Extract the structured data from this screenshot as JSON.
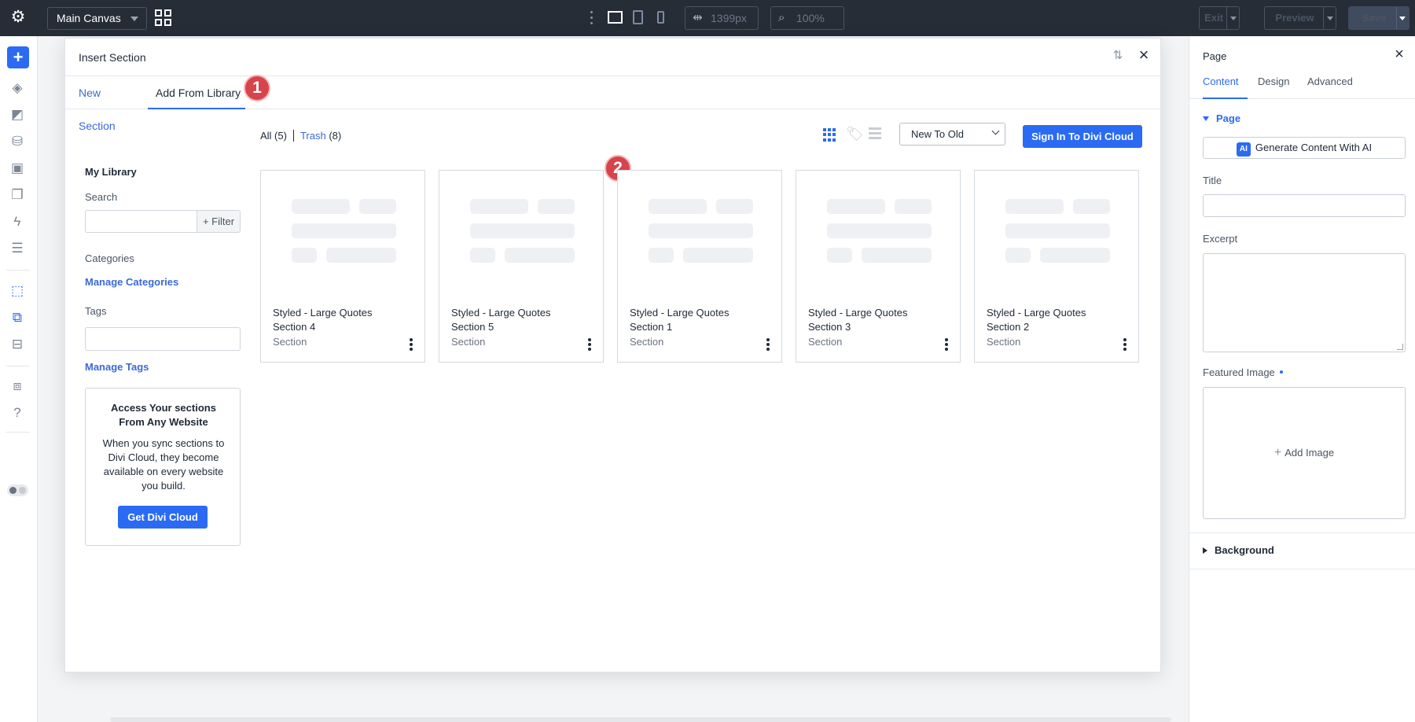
{
  "topbar": {
    "canvas_select": "Main Canvas",
    "width_value": "1399px",
    "zoom_value": "100%",
    "exit_label": "Exit",
    "preview_label": "Preview",
    "save_label": "Save"
  },
  "modal": {
    "title": "Insert Section",
    "tabs": [
      {
        "label": "New Section"
      },
      {
        "label": "Add From Library"
      }
    ],
    "badges": [
      "1",
      "2"
    ]
  },
  "library": {
    "heading": "My Library",
    "search_label": "Search",
    "filter_label": "+ Filter",
    "categories_label": "Categories",
    "manage_categories": "Manage Categories",
    "tags_label": "Tags",
    "manage_tags": "Manage Tags",
    "promo": {
      "title": "Access Your sections From Any Website",
      "body": "When you sync sections to Divi Cloud, they become available on every website you build.",
      "button": "Get Divi Cloud"
    },
    "all_label": "All (5)",
    "trash_label": "Trash",
    "trash_count": "(8)",
    "sort_value": "New To Old",
    "cloud_button": "Sign In To Divi Cloud",
    "items": [
      {
        "title": "Styled - Large Quotes Section 4",
        "type": "Section"
      },
      {
        "title": "Styled - Large Quotes Section 5",
        "type": "Section"
      },
      {
        "title": "Styled - Large Quotes Section 1",
        "type": "Section"
      },
      {
        "title": "Styled - Large Quotes Section 3",
        "type": "Section"
      },
      {
        "title": "Styled - Large Quotes Section 2",
        "type": "Section"
      }
    ]
  },
  "panel": {
    "title": "Page",
    "tabs": [
      {
        "label": "Content"
      },
      {
        "label": "Design"
      },
      {
        "label": "Advanced"
      }
    ],
    "section_page": "Page",
    "ai_button": "Generate Content With AI",
    "ai_icon_text": "AI",
    "title_label": "Title",
    "excerpt_label": "Excerpt",
    "featured_label": "Featured Image",
    "add_image": "Add Image",
    "section_background": "Background"
  },
  "colors": {
    "accent": "#2b6bf3",
    "topbar": "#262d37",
    "badge": "#d8444c"
  }
}
